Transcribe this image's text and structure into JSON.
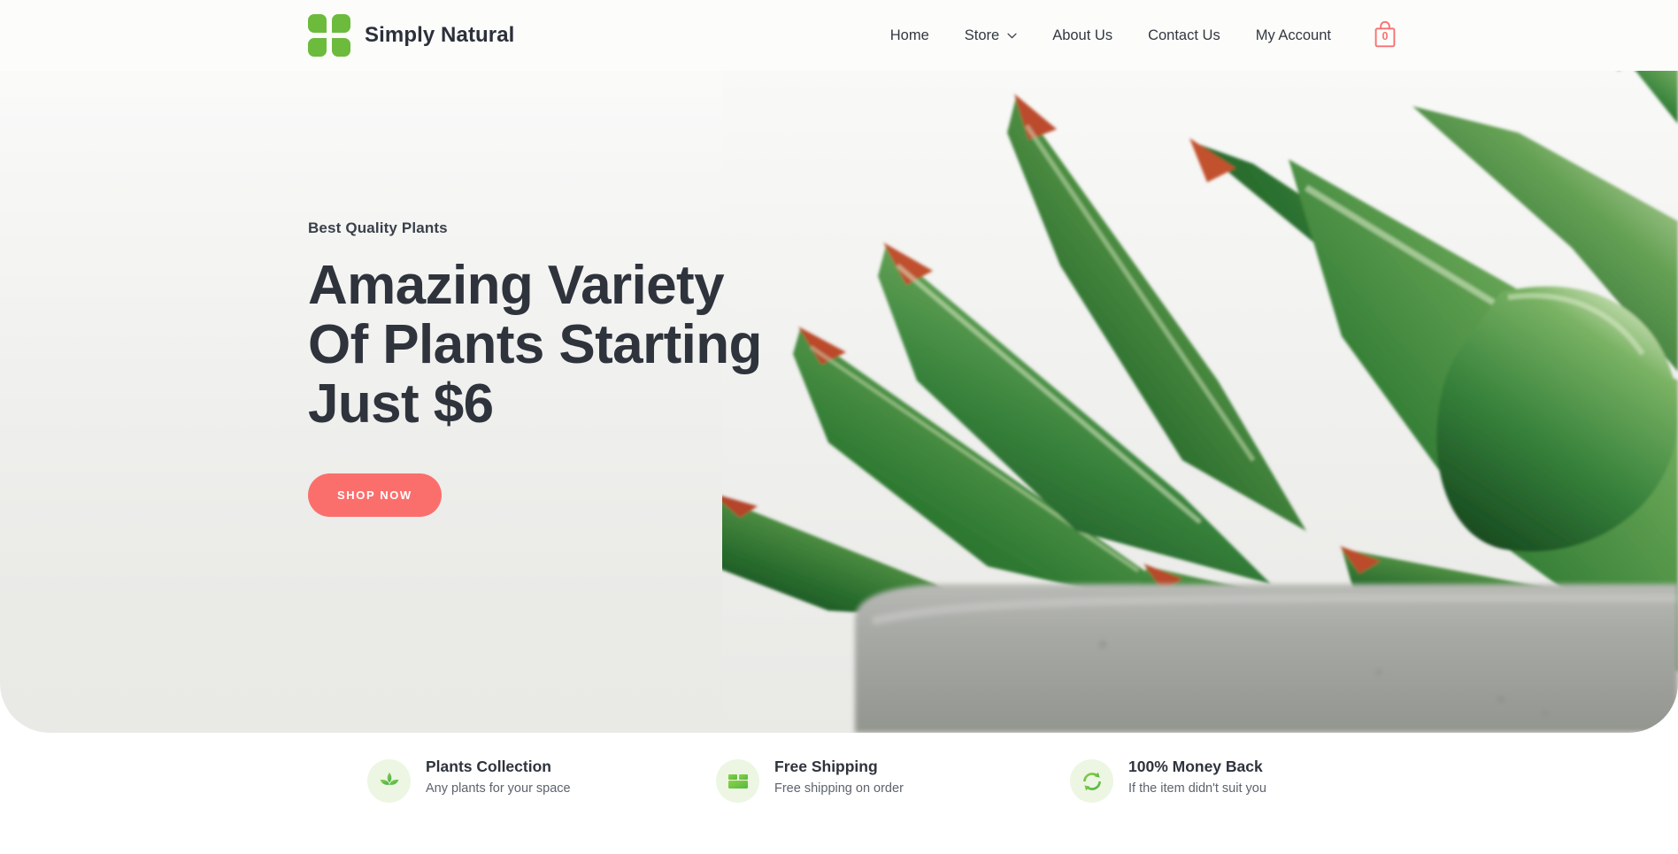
{
  "header": {
    "brand_name": "Simply Natural",
    "logo_icon": "four-rounded-squares-logo",
    "logo_color": "#6cbb3c",
    "nav": [
      {
        "label": "Home",
        "has_dropdown": false
      },
      {
        "label": "Store",
        "has_dropdown": true,
        "dropdown_icon": "chevron-down-icon"
      },
      {
        "label": "About Us",
        "has_dropdown": false
      },
      {
        "label": "Contact Us",
        "has_dropdown": false
      },
      {
        "label": "My Account",
        "has_dropdown": false
      }
    ],
    "cart": {
      "icon": "shopping-bag-icon",
      "count": "0",
      "color": "#f87171"
    }
  },
  "hero": {
    "eyebrow": "Best Quality Plants",
    "headline": "Amazing Variety Of Plants Starting Just $6",
    "headline_lines": [
      "Amazing Variety",
      "Of Plants Starting",
      "Just $6"
    ],
    "cta_label": "SHOP NOW",
    "cta_color": "#fa6f6c",
    "text_color": "#2e333c",
    "background_gradient": [
      "#fdfdfc",
      "#e9e9e6"
    ],
    "image_subject": "green succulent agave plant in gray concrete pot"
  },
  "features": [
    {
      "icon": "plant-leaf-icon",
      "title": "Plants Collection",
      "subtitle": "Any plants for your space"
    },
    {
      "icon": "shipping-box-icon",
      "title": "Free Shipping",
      "subtitle": "Free shipping on order"
    },
    {
      "icon": "refresh-arrows-icon",
      "title": "100% Money Back",
      "subtitle": "If the item didn't suit you"
    }
  ]
}
